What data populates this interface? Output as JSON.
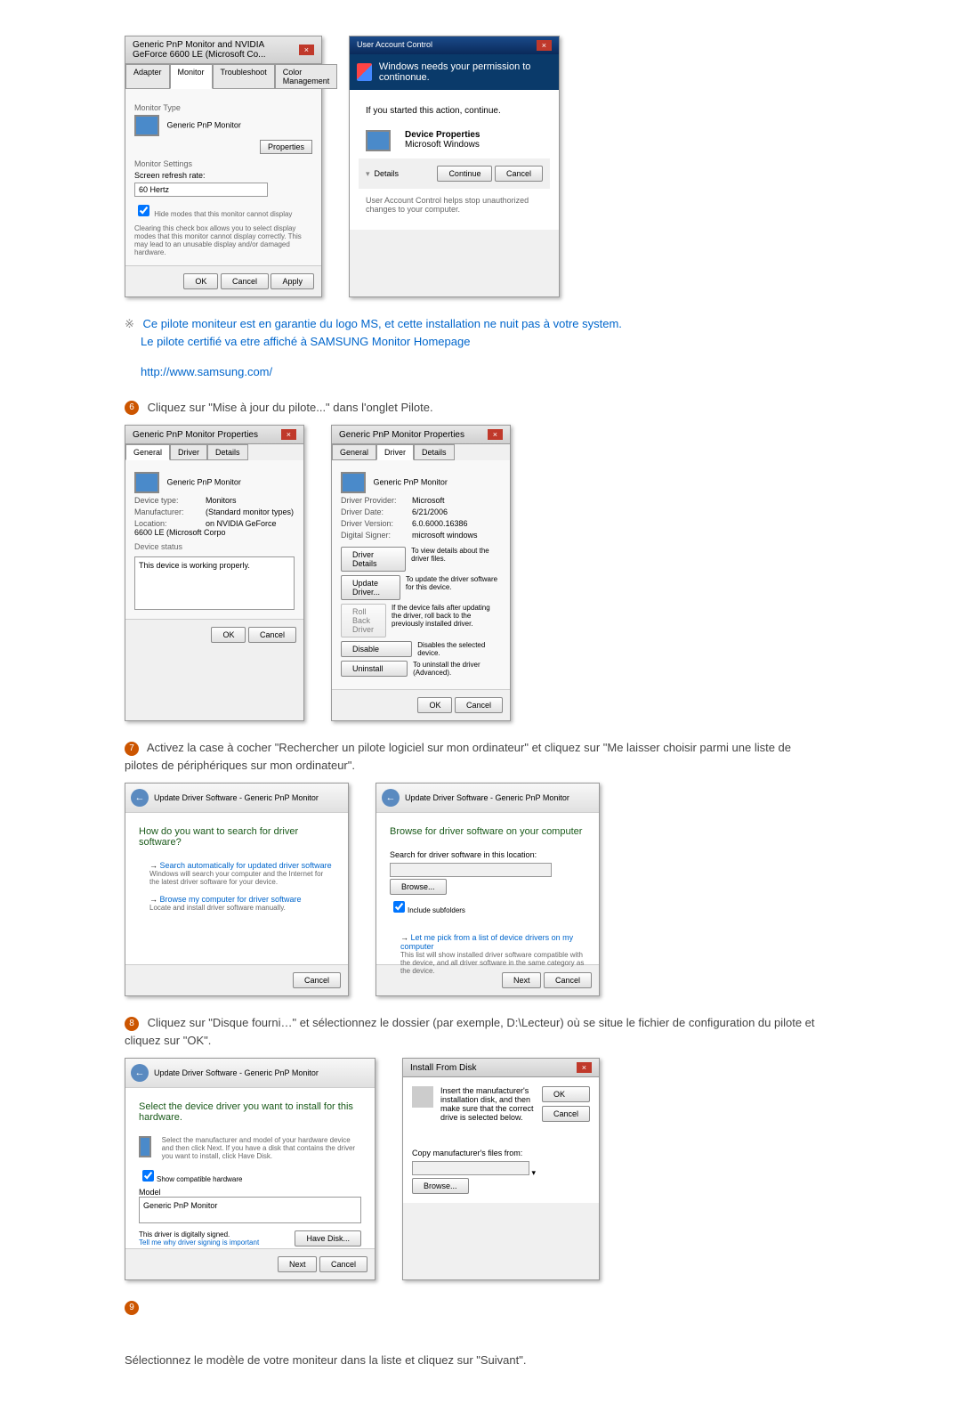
{
  "dialog1": {
    "title": "Generic PnP Monitor and NVIDIA GeForce 6600 LE (Microsoft Co...",
    "tabs": [
      "Adapter",
      "Monitor",
      "Troubleshoot",
      "Color Management"
    ],
    "monitor_type_label": "Monitor Type",
    "monitor_name": "Generic PnP Monitor",
    "properties_btn": "Properties",
    "settings_label": "Monitor Settings",
    "refresh_label": "Screen refresh rate:",
    "refresh_value": "60 Hertz",
    "hide_modes": "Hide modes that this monitor cannot display",
    "hide_desc": "Clearing this check box allows you to select display modes that this monitor cannot display correctly. This may lead to an unusable display and/or damaged hardware.",
    "ok": "OK",
    "cancel": "Cancel",
    "apply": "Apply"
  },
  "uac": {
    "title": "User Account Control",
    "banner": "Windows needs your permission to continonue.",
    "started": "If you started this action, continue.",
    "device_props": "Device Properties",
    "ms_windows": "Microsoft Windows",
    "details": "Details",
    "continue": "Continue",
    "cancel": "Cancel",
    "footer": "User Account Control helps stop unauthorized changes to your computer."
  },
  "note": {
    "line1": "Ce pilote moniteur est en garantie du logo MS, et cette installation ne nuit pas à votre system.",
    "line2": "Le pilote certifié va etre affiché à SAMSUNG Monitor Homepage",
    "link": "http://www.samsung.com/"
  },
  "step6": {
    "text": "Cliquez sur \"Mise à jour du pilote...\" dans l'onglet Pilote.",
    "dialog_a": {
      "title": "Generic PnP Monitor Properties",
      "tabs": [
        "General",
        "Driver",
        "Details"
      ],
      "monitor": "Generic PnP Monitor",
      "device_type_label": "Device type:",
      "device_type": "Monitors",
      "manufacturer_label": "Manufacturer:",
      "manufacturer": "(Standard monitor types)",
      "location_label": "Location:",
      "location": "on NVIDIA GeForce 6600 LE (Microsoft Corpo",
      "status_label": "Device status",
      "status": "This device is working properly.",
      "ok": "OK",
      "cancel": "Cancel"
    },
    "dialog_b": {
      "title": "Generic PnP Monitor Properties",
      "tabs": [
        "General",
        "Driver",
        "Details"
      ],
      "monitor": "Generic PnP Monitor",
      "provider_label": "Driver Provider:",
      "provider": "Microsoft",
      "date_label": "Driver Date:",
      "date": "6/21/2006",
      "version_label": "Driver Version:",
      "version": "6.0.6000.16386",
      "signer_label": "Digital Signer:",
      "signer": "microsoft windows",
      "driver_details": "Driver Details",
      "driver_details_desc": "To view details about the driver files.",
      "update_driver": "Update Driver...",
      "update_desc": "To update the driver software for this device.",
      "rollback": "Roll Back Driver",
      "rollback_desc": "If the device fails after updating the driver, roll back to the previously installed driver.",
      "disable": "Disable",
      "disable_desc": "Disables the selected device.",
      "uninstall": "Uninstall",
      "uninstall_desc": "To uninstall the driver (Advanced).",
      "ok": "OK",
      "cancel": "Cancel"
    }
  },
  "step7": {
    "text": "Activez la case à cocher \"Rechercher un pilote logiciel sur mon ordinateur\" et cliquez sur \"Me laisser choisir parmi une liste de pilotes de périphériques sur mon ordinateur\".",
    "wizard_a": {
      "breadcrumb": "Update Driver Software - Generic PnP Monitor",
      "heading": "How do you want to search for driver software?",
      "opt1_title": "Search automatically for updated driver software",
      "opt1_desc": "Windows will search your computer and the Internet for the latest driver software for your device.",
      "opt2_title": "Browse my computer for driver software",
      "opt2_desc": "Locate and install driver software manually.",
      "cancel": "Cancel"
    },
    "wizard_b": {
      "breadcrumb": "Update Driver Software - Generic PnP Monitor",
      "heading": "Browse for driver software on your computer",
      "search_label": "Search for driver software in this location:",
      "browse": "Browse...",
      "include": "Include subfolders",
      "pick_title": "Let me pick from a list of device drivers on my computer",
      "pick_desc": "This list will show installed driver software compatible with the device, and all driver software in the same category as the device.",
      "next": "Next",
      "cancel": "Cancel"
    }
  },
  "step8": {
    "text": "Cliquez sur \"Disque fourni…\" et sélectionnez le dossier (par exemple, D:\\Lecteur) où se situe le fichier de configuration du pilote et cliquez sur \"OK\".",
    "wizard_a": {
      "breadcrumb": "Update Driver Software - Generic PnP Monitor",
      "heading": "Select the device driver you want to install for this hardware.",
      "desc": "Select the manufacturer and model of your hardware device and then click Next. If you have a disk that contains the driver you want to install, click Have Disk.",
      "show_compat": "Show compatible hardware",
      "model_label": "Model",
      "model": "Generic PnP Monitor",
      "signed": "This driver is digitally signed.",
      "tell_me": "Tell me why driver signing is important",
      "have_disk": "Have Disk...",
      "next": "Next",
      "cancel": "Cancel"
    },
    "install_disk": {
      "title": "Install From Disk",
      "desc": "Insert the manufacturer's installation disk, and then make sure that the correct drive is selected below.",
      "ok": "OK",
      "cancel": "Cancel",
      "copy_label": "Copy manufacturer's files from:",
      "browse": "Browse..."
    }
  },
  "step9": {
    "text": "Sélectionnez le modèle de votre moniteur dans la liste et cliquez sur \"Suivant\"."
  }
}
